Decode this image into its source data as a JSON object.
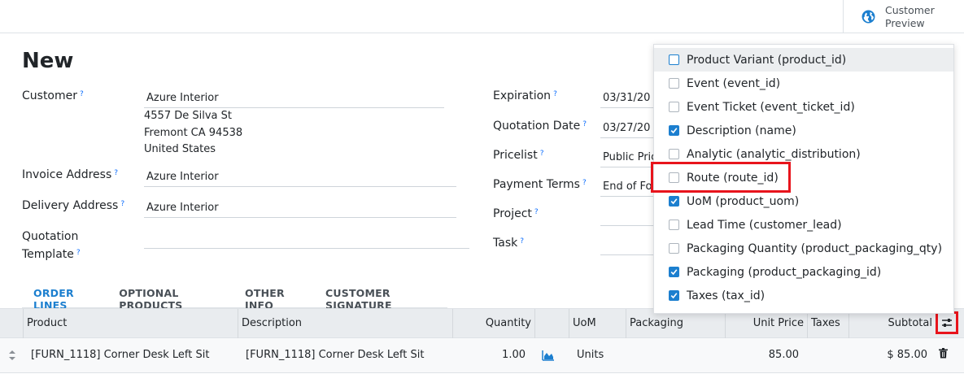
{
  "header": {
    "customer_preview_label": "Customer Preview"
  },
  "form": {
    "title": "New",
    "customer": {
      "label": "Customer",
      "value": "Azure Interior",
      "address": [
        "4557 De Silva St",
        "Fremont CA 94538",
        "United States"
      ]
    },
    "invoice_address": {
      "label": "Invoice Address",
      "value": "Azure Interior"
    },
    "delivery_address": {
      "label": "Delivery Address",
      "value": "Azure Interior"
    },
    "quotation_template": {
      "label": "Quotation Template",
      "value": ""
    },
    "expiration": {
      "label": "Expiration",
      "value": "03/31/20"
    },
    "quotation_date": {
      "label": "Quotation Date",
      "value": "03/27/20"
    },
    "pricelist": {
      "label": "Pricelist",
      "value": "Public Pric"
    },
    "payment_terms": {
      "label": "Payment Terms",
      "value": "End of Fo"
    },
    "project": {
      "label": "Project",
      "value": ""
    },
    "task": {
      "label": "Task",
      "value": ""
    },
    "help_marker": "?"
  },
  "tabs": [
    "ORDER LINES",
    "OPTIONAL PRODUCTS",
    "OTHER INFO",
    "CUSTOMER SIGNATURE"
  ],
  "table": {
    "headers": {
      "product": "Product",
      "description": "Description",
      "quantity": "Quantity",
      "uom": "UoM",
      "packaging": "Packaging",
      "unit_price": "Unit Price",
      "taxes": "Taxes",
      "subtotal": "Subtotal"
    },
    "rows": [
      {
        "product": "[FURN_1118] Corner Desk Left Sit",
        "description": "[FURN_1118] Corner Desk Left Sit",
        "quantity": "1.00",
        "uom": "Units",
        "packaging": "",
        "unit_price": "85.00",
        "taxes": "",
        "subtotal": "$ 85.00"
      }
    ]
  },
  "column_options": [
    {
      "label": "Product Variant (product_id)",
      "checked": false
    },
    {
      "label": "Event (event_id)",
      "checked": false
    },
    {
      "label": "Event Ticket (event_ticket_id)",
      "checked": false
    },
    {
      "label": "Description (name)",
      "checked": true
    },
    {
      "label": "Analytic (analytic_distribution)",
      "checked": false
    },
    {
      "label": "Route (route_id)",
      "checked": false
    },
    {
      "label": "UoM (product_uom)",
      "checked": true
    },
    {
      "label": "Lead Time (customer_lead)",
      "checked": false
    },
    {
      "label": "Packaging Quantity (product_packaging_qty)",
      "checked": false
    },
    {
      "label": "Packaging (product_packaging_id)",
      "checked": true
    },
    {
      "label": "Taxes (tax_id)",
      "checked": true
    }
  ],
  "colors": {
    "accent": "#1c7fcf",
    "annotation": "#e8141c"
  }
}
